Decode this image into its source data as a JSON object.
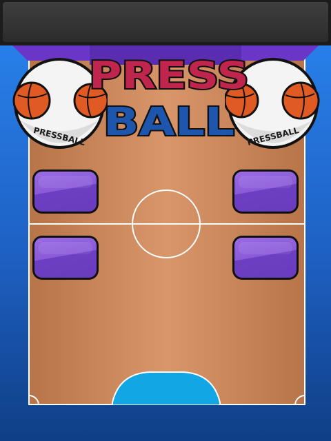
{
  "game": {
    "title_line1": "PRESS",
    "title_line2": "BALL",
    "badge_left_text": "PRESSBALL",
    "badge_right_text": "PRESSBALL"
  },
  "colors": {
    "background_blue": "#2a86f0",
    "court_wood": "#d8966a",
    "court_lines": "#ffffff",
    "paddle_purple": "#8a5ad8",
    "goal_zone": "#12a6e4",
    "header_purple": "#6a36c8",
    "title_red": "#c0254d",
    "title_blue": "#1f56ad",
    "ball_orange": "#e05a23"
  },
  "icons": {
    "ball_badge": "basketball-icon"
  }
}
